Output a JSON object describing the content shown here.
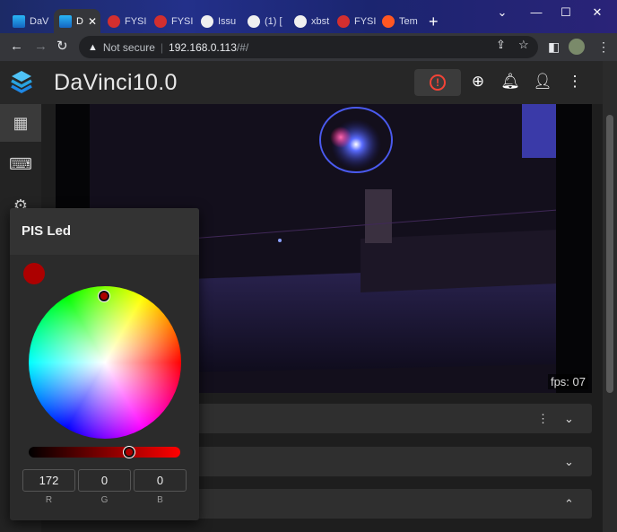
{
  "browser": {
    "tabs": [
      {
        "title": "DaV",
        "icon": "davinci"
      },
      {
        "title": "D",
        "icon": "davinci",
        "active": true
      },
      {
        "title": "FYSI",
        "icon": "fys"
      },
      {
        "title": "FYSI",
        "icon": "fys"
      },
      {
        "title": "Issu",
        "icon": "gh"
      },
      {
        "title": "(1) [",
        "icon": "gh"
      },
      {
        "title": "xbst",
        "icon": "gh"
      },
      {
        "title": "FYSI",
        "icon": "fys"
      },
      {
        "title": "Tem",
        "icon": "red"
      }
    ],
    "new_tab": "+",
    "address": {
      "warning": "Not secure",
      "host": "192.168.0.113",
      "path": "/#/"
    }
  },
  "app": {
    "title": "DaVinci10.0",
    "fps_label": "fps: 07"
  },
  "picker": {
    "title": "PIS Led",
    "color": "#ac0000",
    "r": "172",
    "g": "0",
    "b": "0",
    "r_label": "R",
    "g_label": "G",
    "b_label": "B"
  },
  "colors": {
    "estop": "#f44336",
    "accent": "#1e88e5"
  }
}
